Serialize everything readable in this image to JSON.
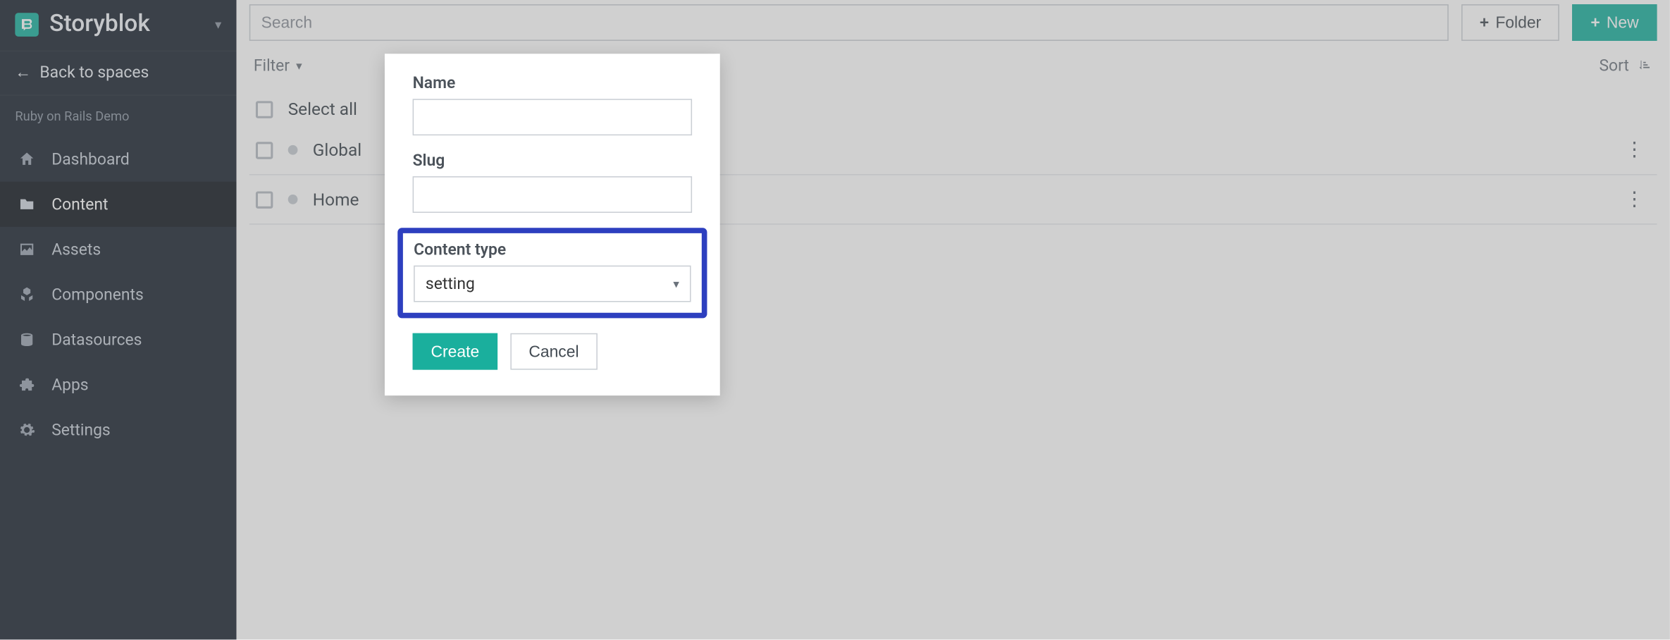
{
  "brand": {
    "name": "Storyblok"
  },
  "sidebar": {
    "back_label": "Back to spaces",
    "space_name": "Ruby on Rails Demo",
    "items": [
      {
        "label": "Dashboard",
        "icon": "home-icon"
      },
      {
        "label": "Content",
        "icon": "folder-icon",
        "active": true
      },
      {
        "label": "Assets",
        "icon": "image-icon"
      },
      {
        "label": "Components",
        "icon": "cubes-icon"
      },
      {
        "label": "Datasources",
        "icon": "database-icon"
      },
      {
        "label": "Apps",
        "icon": "puzzle-icon"
      },
      {
        "label": "Settings",
        "icon": "gear-icon"
      }
    ]
  },
  "toolbar": {
    "search_placeholder": "Search",
    "folder_label": "Folder",
    "new_label": "New"
  },
  "filter": {
    "label": "Filter",
    "sort_label": "Sort"
  },
  "list": {
    "select_all_label": "Select all",
    "rows": [
      {
        "label": "Global"
      },
      {
        "label": "Home"
      }
    ]
  },
  "modal": {
    "name_label": "Name",
    "name_value": "",
    "slug_label": "Slug",
    "slug_value": "",
    "content_type_label": "Content type",
    "content_type_value": "setting",
    "create_label": "Create",
    "cancel_label": "Cancel"
  }
}
